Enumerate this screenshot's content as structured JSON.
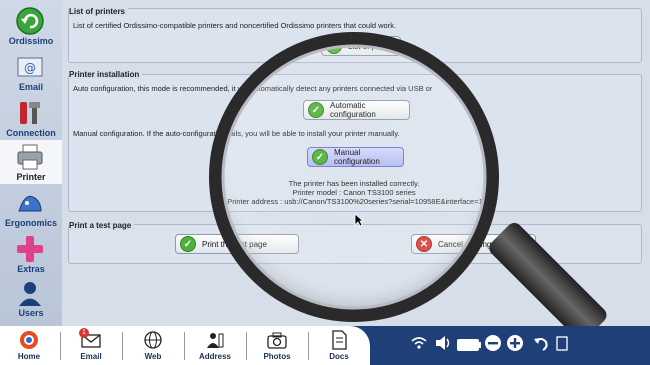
{
  "sidebar": {
    "items": [
      {
        "label": "Ordissimo"
      },
      {
        "label": "Email"
      },
      {
        "label": "Connection"
      },
      {
        "label": "Printer"
      },
      {
        "label": "Ergonomics"
      },
      {
        "label": "Extras"
      },
      {
        "label": "Users"
      }
    ]
  },
  "list_of_printers": {
    "title": "List of printers",
    "description": "List of certified Ordissimo-compatible printers and noncertified Ordissimo printers that could work.",
    "button": "List of printers"
  },
  "printer_installation": {
    "title": "Printer installation",
    "auto_text": "Auto configuration, this mode is recommended, it will automatically detect any printers connected via USB or",
    "auto_button": "Automatic configuration",
    "manual_text": "Manual configuration. If the auto-configuration fails, you will be able to install your printer manually.",
    "manual_button": "Manual configuration",
    "status_line1": "The printer has been installed correctly.",
    "status_line2": "Printer model : Canon TS3100 series",
    "status_line3": "Printer address : usb://Canon/TS3100%20series?serial=10958E&interface=1"
  },
  "test_page": {
    "title": "Print a test page",
    "print_button": "Print the test page",
    "cancel_button": "Cancel printing in progress"
  },
  "bottom_bar": {
    "items": [
      {
        "label": "Home"
      },
      {
        "label": "Email",
        "badge": "1"
      },
      {
        "label": "Web"
      },
      {
        "label": "Address"
      },
      {
        "label": "Photos"
      },
      {
        "label": "Docs"
      }
    ]
  },
  "colors": {
    "accent": "#1f3f78",
    "ok": "#4fb23a",
    "cancel": "#d9352d"
  }
}
